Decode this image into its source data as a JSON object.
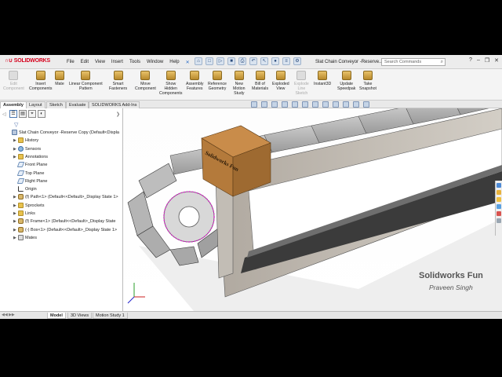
{
  "app": {
    "logo": "SOLIDWORKS",
    "doc_title": "Slat Chain Conveyor -Reserve..."
  },
  "menu": [
    "File",
    "Edit",
    "View",
    "Insert",
    "Tools",
    "Window",
    "Help"
  ],
  "search": {
    "placeholder": "Search Commands"
  },
  "commands": [
    {
      "label": "Edit\nComponent",
      "enabled": false
    },
    {
      "label": "Insert\nComponents",
      "enabled": true
    },
    {
      "label": "Mate",
      "enabled": true
    },
    {
      "label": "Linear Component\nPattern",
      "enabled": true
    },
    {
      "label": "Smart\nFasteners",
      "enabled": true
    },
    {
      "label": "Move\nComponent",
      "enabled": true
    },
    {
      "label": "Show\nHidden\nComponents",
      "enabled": true
    },
    {
      "label": "Assembly\nFeatures",
      "enabled": true
    },
    {
      "label": "Reference\nGeometry",
      "enabled": true
    },
    {
      "label": "New\nMotion\nStudy",
      "enabled": true
    },
    {
      "label": "Bill of\nMaterials",
      "enabled": true
    },
    {
      "label": "Exploded\nView",
      "enabled": true
    },
    {
      "label": "Explode\nLine\nSketch",
      "enabled": false
    },
    {
      "label": "Instant3D",
      "enabled": true
    },
    {
      "label": "Update\nSpeedpak",
      "enabled": true
    },
    {
      "label": "Take\nSnapshot",
      "enabled": true
    }
  ],
  "cm_tabs": [
    "Assembly",
    "Layout",
    "Sketch",
    "Evaluate",
    "SOLIDWORKS Add-Ins"
  ],
  "tree": {
    "root": "Slat Chain Conveyor -Reserve Copy  (Default<Displa",
    "items": [
      {
        "label": "History",
        "icon": "folder"
      },
      {
        "label": "Sensors",
        "icon": "sensor"
      },
      {
        "label": "Annotations",
        "icon": "folder"
      },
      {
        "label": "Front Plane",
        "icon": "plane"
      },
      {
        "label": "Top Plane",
        "icon": "plane"
      },
      {
        "label": "Right Plane",
        "icon": "plane"
      },
      {
        "label": "Origin",
        "icon": "origin"
      },
      {
        "label": "(f) Path<1> (Default<<Default>_Display State 1>",
        "icon": "part"
      },
      {
        "label": "Sprockets",
        "icon": "folder"
      },
      {
        "label": "Links",
        "icon": "folder"
      },
      {
        "label": "(f) Frame<1> (Default<<Default>_Display State",
        "icon": "part"
      },
      {
        "label": "(-) Box<1> (Default<<Default>_Display State 1>",
        "icon": "part"
      },
      {
        "label": "Mates",
        "icon": "mates"
      }
    ]
  },
  "bottom_tabs": [
    "Model",
    "3D Views",
    "Motion Study 1"
  ],
  "box_label": "Solidworks Fun",
  "watermark": {
    "line1": "Solidworks Fun",
    "line2": "Praveen Singh"
  }
}
